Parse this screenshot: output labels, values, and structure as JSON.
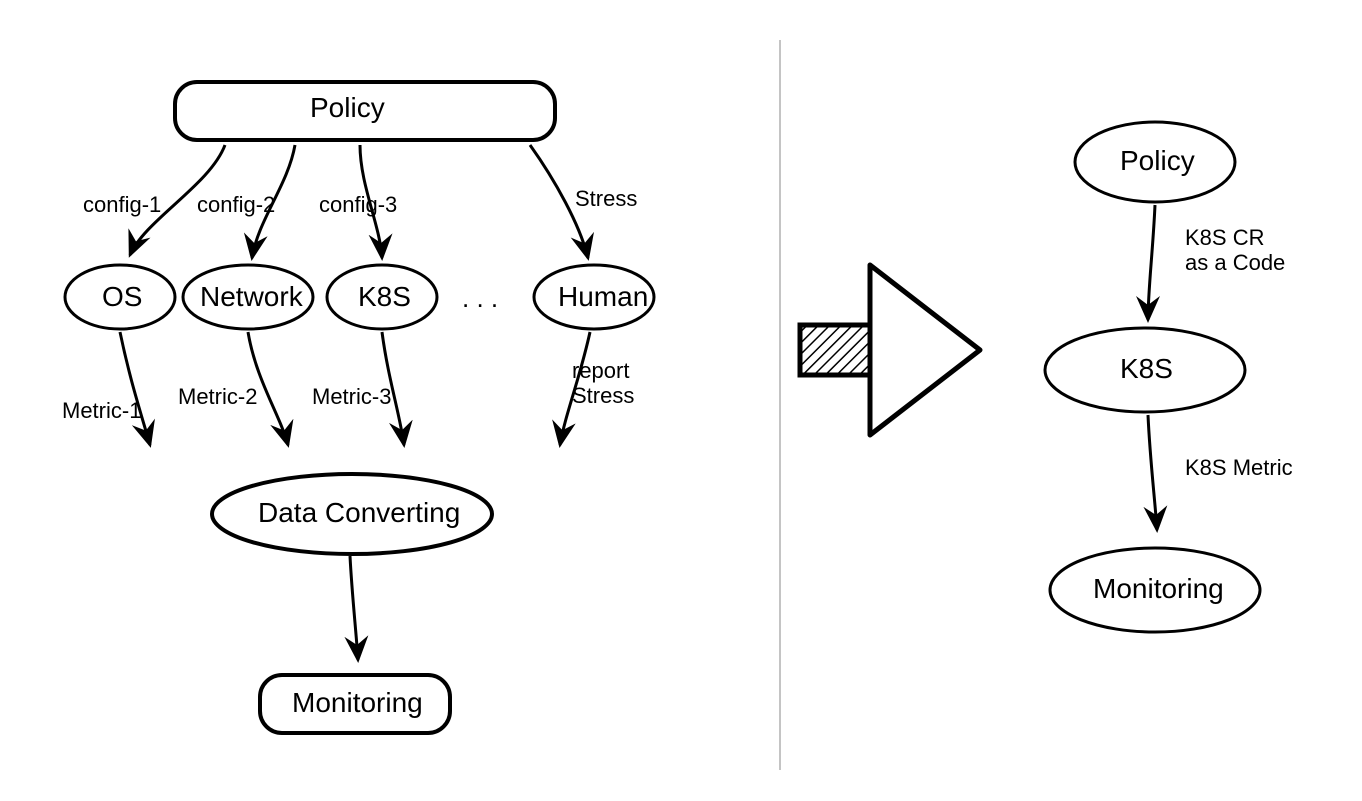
{
  "diagram": {
    "left": {
      "policy": "Policy",
      "nodes": {
        "os": "OS",
        "network": "Network",
        "k8s": "K8S",
        "human": "Human"
      },
      "dots": ". . .",
      "data_converting": "Data Converting",
      "monitoring": "Monitoring",
      "edge_labels_top": {
        "config1": "config-1",
        "config2": "config-2",
        "config3": "config-3",
        "stress": "Stress"
      },
      "edge_labels_bottom": {
        "metric1": "Metric-1",
        "metric2": "Metric-2",
        "metric3": "Metric-3",
        "report_stress": "report\nStress"
      }
    },
    "right": {
      "policy": "Policy",
      "k8s": "K8S",
      "monitoring": "Monitoring",
      "edge1": "K8S CR\nas a Code",
      "edge2": "K8S Metric"
    }
  }
}
